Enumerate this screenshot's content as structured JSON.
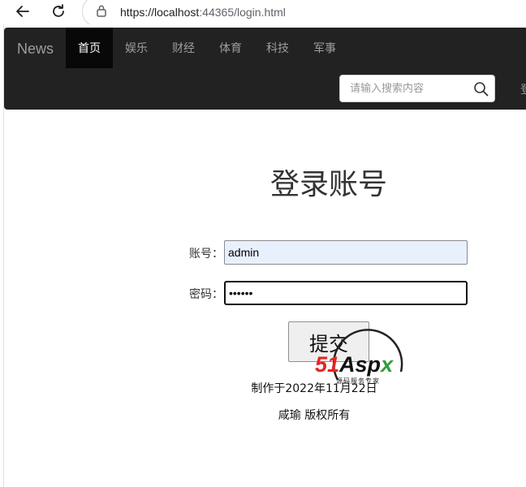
{
  "browser": {
    "url_host": "https://localhost",
    "url_rest": ":44365/login.html"
  },
  "navbar": {
    "brand": "News",
    "items": [
      {
        "label": "首页",
        "active": true
      },
      {
        "label": "娱乐",
        "active": false
      },
      {
        "label": "财经",
        "active": false
      },
      {
        "label": "体育",
        "active": false
      },
      {
        "label": "科技",
        "active": false
      },
      {
        "label": "军事",
        "active": false
      }
    ],
    "search_placeholder": "请输入搜索内容",
    "cut_off_link": "登"
  },
  "login": {
    "title": "登录账号",
    "username_label": "账号：",
    "username_value": "admin",
    "password_label": "密码：",
    "password_value": "••••••",
    "submit_label": "提交",
    "made_on": "制作于2022年11月22日",
    "copyright": "咸瑜 版权所有"
  },
  "watermark": {
    "logo_num": "51",
    "logo_text": "Asp",
    "logo_x": "x",
    "tagline": "源码服务专家"
  },
  "icons": [
    "back-icon",
    "refresh-icon",
    "lock-icon",
    "search-icon"
  ]
}
